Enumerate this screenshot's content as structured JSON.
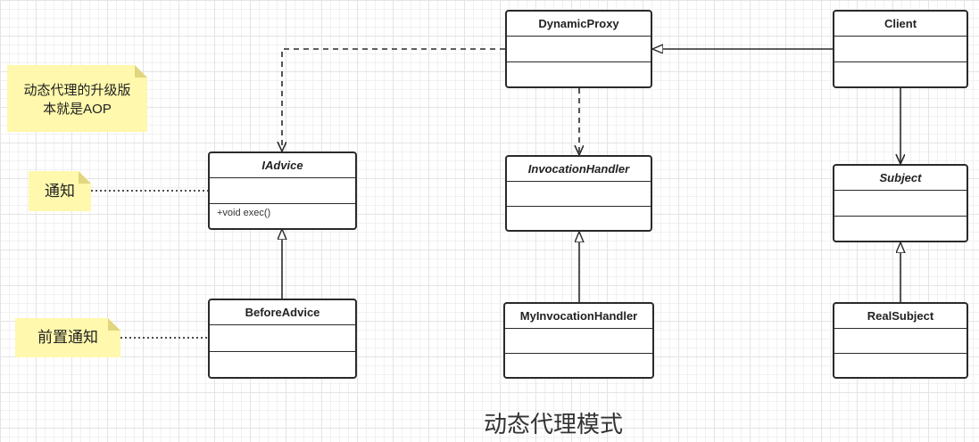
{
  "classes": {
    "dynamic_proxy": {
      "name": "DynamicProxy"
    },
    "client": {
      "name": "Client"
    },
    "iadvice": {
      "name": "IAdvice",
      "operation": "+void exec()"
    },
    "invocation_handler": {
      "name": "InvocationHandler"
    },
    "subject": {
      "name": "Subject"
    },
    "before_advice": {
      "name": "BeforeAdvice"
    },
    "my_invocation_handler": {
      "name": "MyInvocationHandler"
    },
    "real_subject": {
      "name": "RealSubject"
    }
  },
  "notes": {
    "aop_note_line1": "动态代理的升级版",
    "aop_note_line2": "本就是AOP",
    "advice_note": "通知",
    "before_advice_note": "前置通知"
  },
  "caption": "动态代理模式",
  "colors": {
    "note_fill": "#fff8ad",
    "line": "#2a2a2a",
    "grid": "#e4e4e4"
  }
}
